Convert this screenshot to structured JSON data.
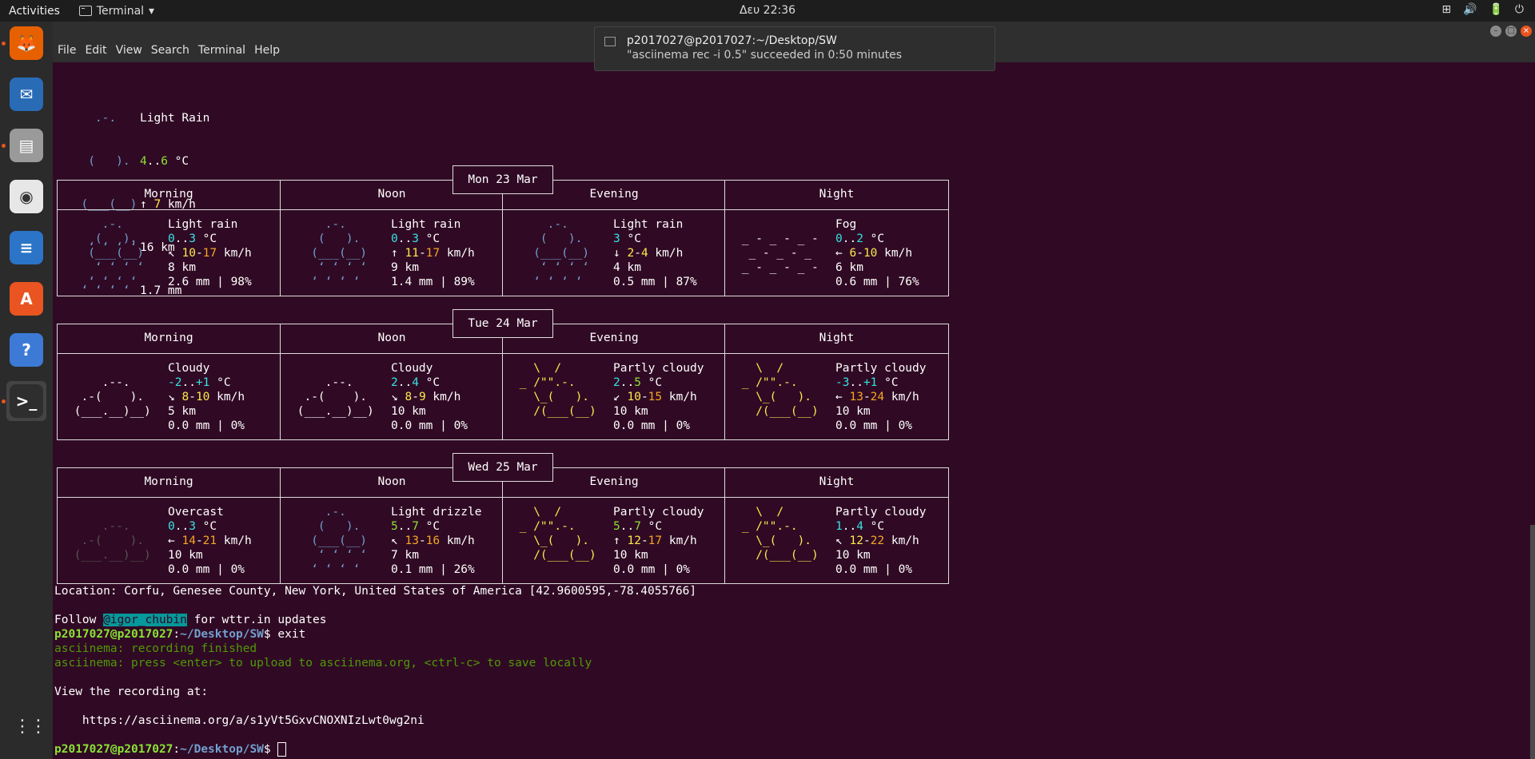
{
  "topbar": {
    "activities": "Activities",
    "app_name": "Terminal",
    "app_caret": "▾",
    "clock": "Δευ 22:36",
    "tray_icons": [
      "network-icon",
      "volume-icon",
      "battery-icon",
      "power-icon"
    ],
    "tray_glyphs": [
      "⊞",
      "🔊",
      "🔋",
      "⏻"
    ]
  },
  "dock": {
    "items": [
      {
        "name": "firefox",
        "color": "#e66000",
        "glyph": "🦊",
        "running": true
      },
      {
        "name": "thunderbird",
        "color": "#2a6bb6",
        "glyph": "✉",
        "running": false
      },
      {
        "name": "files",
        "color": "#9a9a9a",
        "glyph": "▤",
        "running": true
      },
      {
        "name": "rhythmbox",
        "color": "#e7e7e7",
        "glyph": "◉",
        "running": false
      },
      {
        "name": "libreoffice-writer",
        "color": "#2b74c7",
        "glyph": "≡",
        "running": false
      },
      {
        "name": "ubuntu-software",
        "color": "#e95420",
        "glyph": "A",
        "running": false
      },
      {
        "name": "help",
        "color": "#3c7ad6",
        "glyph": "?",
        "running": false
      },
      {
        "name": "terminal",
        "color": "#2e2e2e",
        "glyph": ">_",
        "running": true
      }
    ],
    "apps_grid": "⋮⋮⋮"
  },
  "menubar": [
    "File",
    "Edit",
    "View",
    "Search",
    "Terminal",
    "Help"
  ],
  "notification": {
    "title": "p2017027@p2017027:~/Desktop/SW",
    "body": "\"asciinema rec -i 0.5\" succeeded in 0:50 minutes"
  },
  "current": {
    "art": [
      "    .-.   ",
      "   (   ).  ",
      "  (___(__) ",
      "   ʻ ʻ ʻ ʻ  ",
      "  ʻ ʻ ʻ ʻ   "
    ],
    "desc": "Light Rain",
    "temp_a": "4",
    "temp_sep": "..",
    "temp_b": "6",
    "temp_unit": " °C",
    "wind_arrow": "↑ ",
    "wind": "7",
    "wind_unit": " km/h",
    "vis": "16 km",
    "precip": "1.7 mm"
  },
  "periods": [
    "Morning",
    "Noon",
    "Evening",
    "Night"
  ],
  "days": [
    {
      "date": "Mon 23 Mar",
      "cells": [
        {
          "art": "rain",
          "desc": "Light rain",
          "t1": "0",
          "t2": "3",
          "warrow": "↖ ",
          "w1": "10",
          "w2": "17",
          "vis": "8 km",
          "precip": "2.6 mm | 98%"
        },
        {
          "art": "rain",
          "desc": "Light rain",
          "t1": "0",
          "t2": "3",
          "warrow": "↑ ",
          "w1": "11",
          "w2": "17",
          "vis": "9 km",
          "precip": "1.4 mm | 89%"
        },
        {
          "art": "rain",
          "desc": "Light rain",
          "t1": "3",
          "t2": "",
          "warrow": "↓ ",
          "w1": "2",
          "w2": "4",
          "vis": "4 km",
          "precip": "0.5 mm | 87%"
        },
        {
          "art": "fog",
          "desc": "Fog",
          "t1": "0",
          "t2": "2",
          "warrow": "← ",
          "w1": "6",
          "w2": "10",
          "vis": "6 km",
          "precip": "0.6 mm | 76%"
        }
      ]
    },
    {
      "date": "Tue 24 Mar",
      "cells": [
        {
          "art": "cloudy",
          "desc": "Cloudy",
          "t1": "-2",
          "t2": "+1",
          "warrow": "↘ ",
          "w1": "8",
          "w2": "10",
          "vis": "5 km",
          "precip": "0.0 mm | 0%"
        },
        {
          "art": "cloudy",
          "desc": "Cloudy",
          "t1": "2",
          "t2": "4",
          "warrow": "↘ ",
          "w1": "8",
          "w2": "9",
          "vis": "10 km",
          "precip": "0.0 mm | 0%"
        },
        {
          "art": "partly",
          "desc": "Partly cloudy",
          "t1": "2",
          "t2": "5",
          "warrow": "↙ ",
          "w1": "10",
          "w2": "15",
          "vis": "10 km",
          "precip": "0.0 mm | 0%"
        },
        {
          "art": "partly",
          "desc": "Partly cloudy",
          "t1": "-3",
          "t2": "+1",
          "warrow": "← ",
          "w1": "13",
          "w2": "24",
          "vis": "10 km",
          "precip": "0.0 mm | 0%"
        }
      ]
    },
    {
      "date": "Wed 25 Mar",
      "cells": [
        {
          "art": "overcast",
          "desc": "Overcast",
          "t1": "0",
          "t2": "3",
          "warrow": "← ",
          "w1": "14",
          "w2": "21",
          "vis": "10 km",
          "precip": "0.0 mm | 0%"
        },
        {
          "art": "rain",
          "desc": "Light drizzle",
          "t1": "5",
          "t2": "7",
          "warrow": "↖ ",
          "w1": "13",
          "w2": "16",
          "vis": "7 km",
          "precip": "0.1 mm | 26%"
        },
        {
          "art": "partly",
          "desc": "Partly cloudy",
          "t1": "5",
          "t2": "7",
          "warrow": "↑ ",
          "w1": "12",
          "w2": "17",
          "vis": "10 km",
          "precip": "0.0 mm | 0%"
        },
        {
          "art": "partly",
          "desc": "Partly cloudy",
          "t1": "1",
          "t2": "4",
          "warrow": "↖ ",
          "w1": "12",
          "w2": "22",
          "vis": "10 km",
          "precip": "0.0 mm | 0%"
        }
      ]
    }
  ],
  "arts": {
    "rain": [
      "     .-.     ",
      "    (   ).   ",
      "   (___(__)  ",
      "    ʻ ʻ ʻ ʻ  ",
      "   ʻ ʻ ʻ ʻ   "
    ],
    "fog": [
      "             ",
      " _ - _ - _ -  ",
      "  _ - _ - _   ",
      " _ - _ - _ -  ",
      "             "
    ],
    "cloudy": [
      "             ",
      "     .--.    ",
      "  .-(    ).  ",
      " (___.__)__) ",
      "             "
    ],
    "overcast": [
      "             ",
      "     .--.    ",
      "  .-(    ).  ",
      " (___.__)__) ",
      "             "
    ],
    "partly": [
      "   \\  /      ",
      " _ /\"\".-.    ",
      "   \\_(   ).  ",
      "   /(___(__) ",
      "             "
    ]
  },
  "footer": {
    "location": "Location: Corfu, Genesee County, New York, United States of America [42.9600595,-78.4055766]",
    "follow_pre": "Follow ",
    "follow_handle": "@igor_chubin",
    "follow_post": " for wttr.in updates",
    "prompt_user": "p2017027@p2017027",
    "prompt_sep": ":",
    "prompt_path": "~/Desktop/SW",
    "prompt_end": "$ ",
    "cmd_exit": "exit",
    "rec_finished": "asciinema: recording finished",
    "rec_press": "asciinema: press <enter> to upload to asciinema.org, <ctrl-c> to save locally",
    "view_at": "View the recording at:",
    "url": "    https://asciinema.org/a/s1yVt5GxvCNOXNIzLwt0wg2ni"
  },
  "colors": {
    "bg": "#300a24",
    "green": "#8ae234",
    "blue": "#729fcf",
    "yellow": "#fce94f",
    "orange": "#f5a623",
    "cyan": "#34e2e2"
  }
}
